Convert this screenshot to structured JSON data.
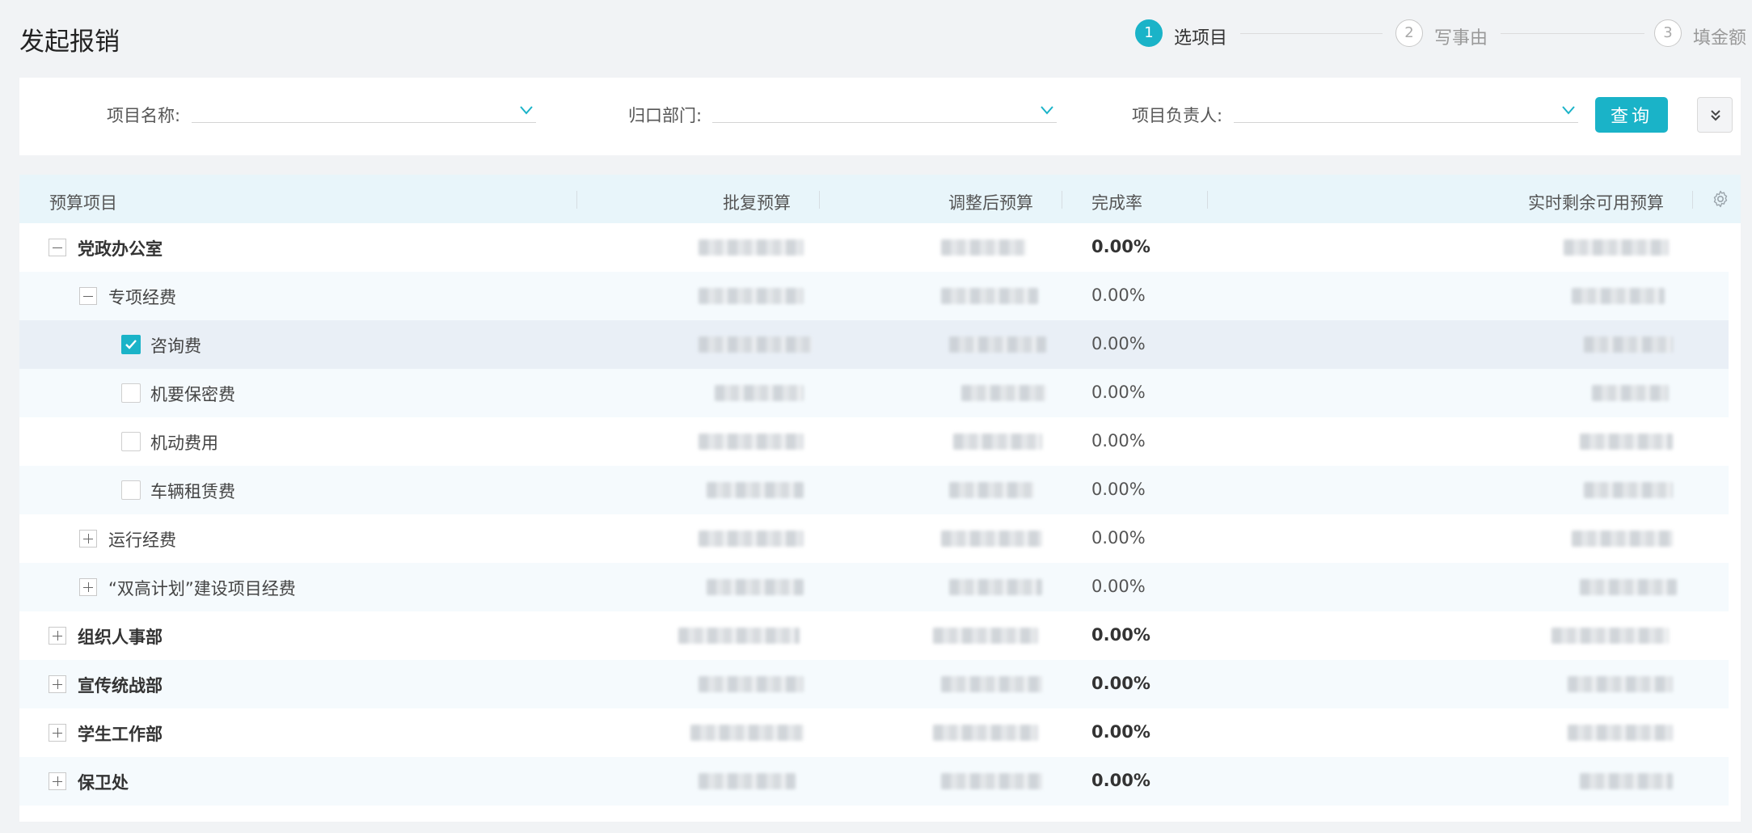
{
  "page": {
    "title": "发起报销"
  },
  "steps": [
    {
      "num": "1",
      "label": "选项目",
      "state": "active"
    },
    {
      "num": "2",
      "label": "写事由",
      "state": "todo"
    },
    {
      "num": "3",
      "label": "填金额",
      "state": "todo"
    }
  ],
  "filters": {
    "project_name": {
      "label": "项目名称:",
      "value": ""
    },
    "department": {
      "label": "归口部门:",
      "value": ""
    },
    "owner": {
      "label": "项目负责人:",
      "value": ""
    },
    "query_label": "查询"
  },
  "table": {
    "headers": {
      "item": "预算项目",
      "approved": "批复预算",
      "adjusted": "调整后预算",
      "completion": "完成率",
      "remaining": "实时剩余可用预算"
    },
    "rows": [
      {
        "name": "党政办公室",
        "level": 0,
        "control": "collapse",
        "bold": true,
        "completion": "0.00%"
      },
      {
        "name": "专项经费",
        "level": 1,
        "control": "collapse",
        "bold": false,
        "completion": "0.00%"
      },
      {
        "name": "咨询费",
        "level": 2,
        "control": "checkbox",
        "checked": true,
        "bold": false,
        "completion": "0.00%"
      },
      {
        "name": "机要保密费",
        "level": 2,
        "control": "checkbox",
        "checked": false,
        "bold": false,
        "completion": "0.00%"
      },
      {
        "name": "机动费用",
        "level": 2,
        "control": "checkbox",
        "checked": false,
        "bold": false,
        "completion": "0.00%"
      },
      {
        "name": "车辆租赁费",
        "level": 2,
        "control": "checkbox",
        "checked": false,
        "bold": false,
        "completion": "0.00%"
      },
      {
        "name": "运行经费",
        "level": 1,
        "control": "expand",
        "bold": false,
        "completion": "0.00%"
      },
      {
        "name": "“双高计划”建设项目经费",
        "level": 1,
        "control": "expand",
        "bold": false,
        "completion": "0.00%"
      },
      {
        "name": "组织人事部",
        "level": 0,
        "control": "expand",
        "bold": true,
        "completion": "0.00%"
      },
      {
        "name": "宣传统战部",
        "level": 0,
        "control": "expand",
        "bold": true,
        "completion": "0.00%"
      },
      {
        "name": "学生工作部",
        "level": 0,
        "control": "expand",
        "bold": true,
        "completion": "0.00%"
      },
      {
        "name": "保卫处",
        "level": 0,
        "control": "expand",
        "bold": true,
        "completion": "0.00%"
      }
    ]
  },
  "colors": {
    "accent": "#1ab3c8",
    "header_bg": "#e8f5fa",
    "selected_row": "#e9eff6"
  },
  "icons": [
    "chevron-down-icon",
    "double-chevron-down-icon",
    "settings-gear-icon",
    "checkmark-icon"
  ]
}
